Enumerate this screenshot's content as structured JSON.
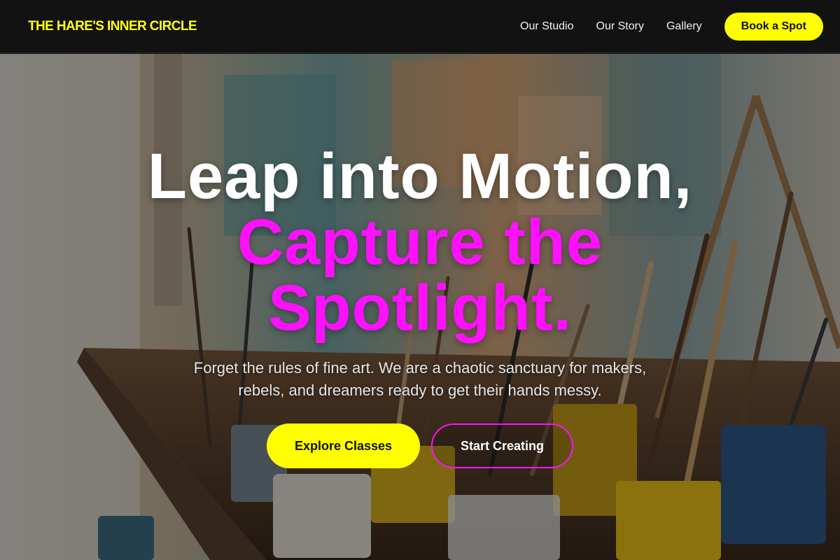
{
  "nav": {
    "logo": "THE HARE'S INNER CIRCLE",
    "links": [
      "Our Studio",
      "Our Story",
      "Gallery"
    ],
    "cta": "Book a Spot"
  },
  "hero": {
    "headline_line1": "Leap into Motion,",
    "headline_line2a": "Capture the",
    "headline_line2b": "Spotlight.",
    "subtext": "Forget the rules of fine art. We are a chaotic sanctuary for makers, rebels, and dreamers ready to get their hands messy.",
    "primary_button": "Explore Classes",
    "secondary_button": "Start Creating",
    "background_image": "art-studio-brushes-photo"
  },
  "colors": {
    "accent_yellow": "#ffff00",
    "accent_magenta": "#ff10ff",
    "nav_background": "#121212"
  }
}
